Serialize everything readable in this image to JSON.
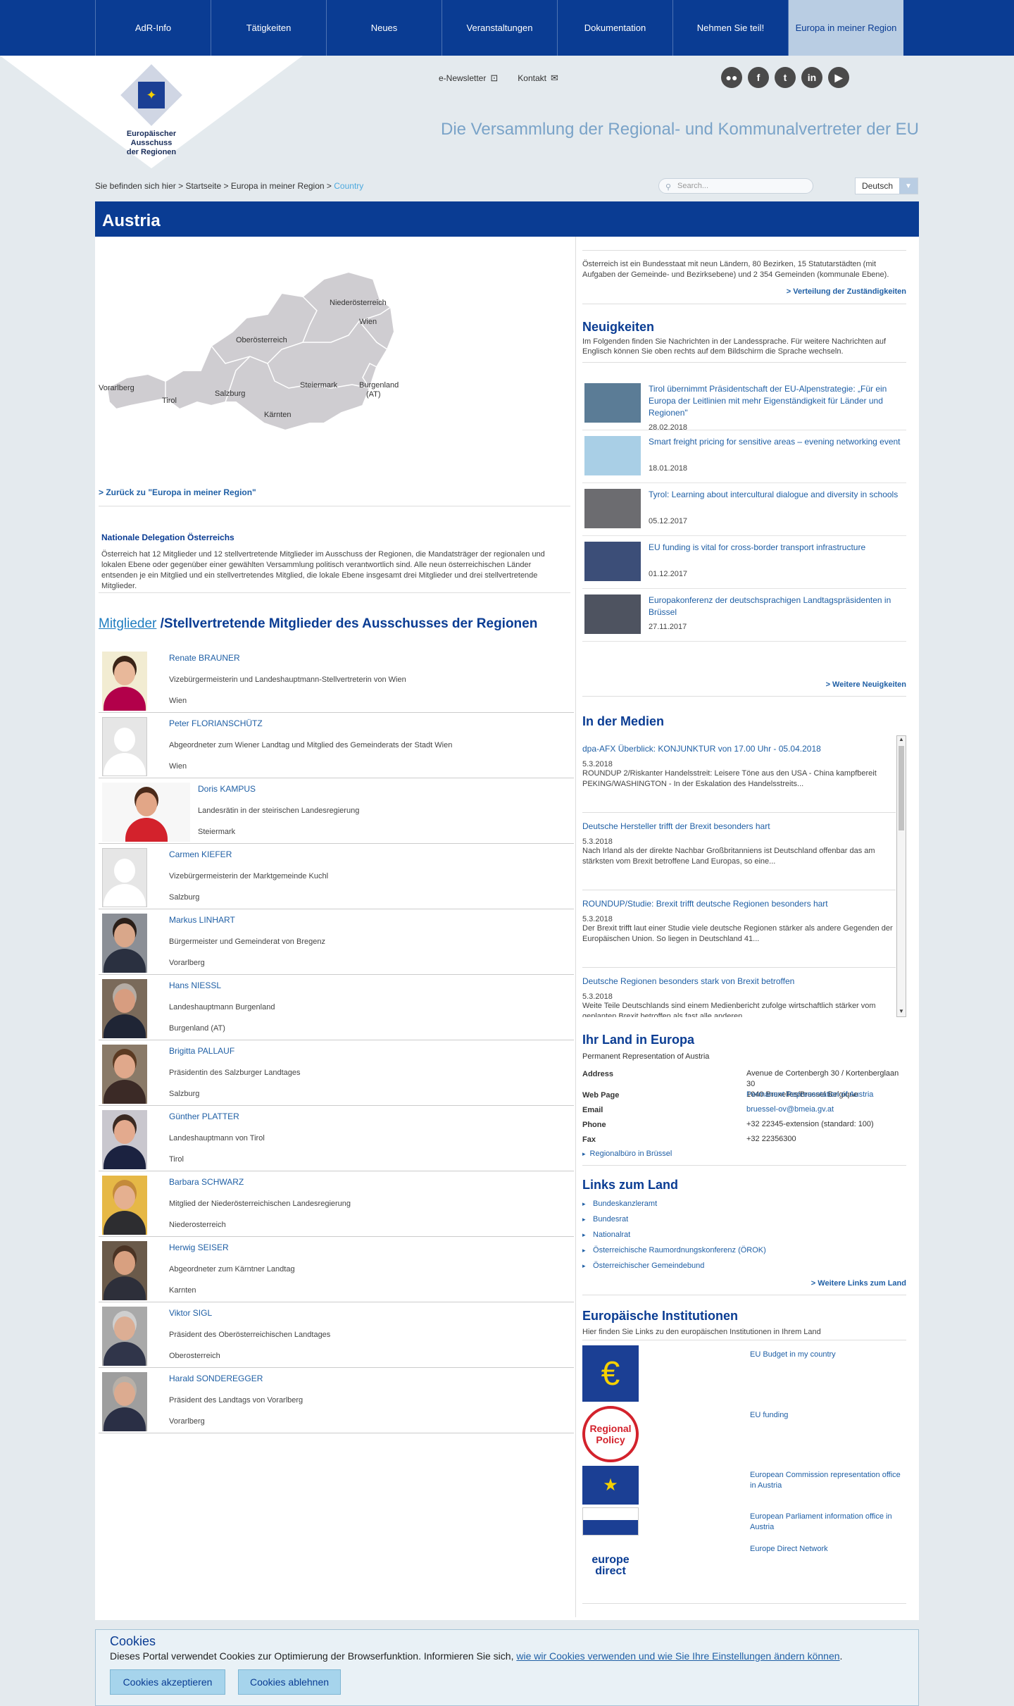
{
  "nav": [
    "AdR-Info",
    "Tätigkeiten",
    "Neues",
    "Veranstaltungen",
    "Dokumentation",
    "Nehmen Sie teil!",
    "Europa in meiner Region"
  ],
  "logo": {
    "line1": "Europäischer Ausschuss",
    "line2": "der Regionen"
  },
  "tools": {
    "newsletter": "e-Newsletter",
    "contact": "Kontakt"
  },
  "social": [
    "flickr-icon",
    "facebook-icon",
    "twitter-icon",
    "linkedin-icon",
    "youtube-icon"
  ],
  "tagline": "Die Versammlung der Regional- und Kommunalvertreter der EU",
  "breadcrumb": {
    "prefix": "Sie befinden sich hier >",
    "home": "Startseite",
    "section": "Europa in meiner Region",
    "current": "Country"
  },
  "search": {
    "placeholder": "Search..."
  },
  "language": "Deutsch",
  "page_title": "Austria",
  "map_regions": [
    "Niederösterreich",
    "Wien",
    "Oberösterreich",
    "Vorarlberg",
    "Tirol",
    "Salzburg",
    "Steiermark",
    "Burgenland",
    "(AT)",
    "Kärnten"
  ],
  "back_link": "> Zurück zu \"Europa in meiner Region\"",
  "delegation": {
    "title": "Nationale Delegation Österreichs",
    "text": "Österreich hat 12 Mitglieder und 12 stellvertretende Mitglieder im Ausschuss der Regionen, die Mandatsträger der regionalen und lokalen Ebene oder gegenüber einer gewählten Versammlung politisch verantwortlich sind. Alle neun österreichischen Länder entsenden je ein Mitglied und ein stellvertretendes Mitglied, die lokale Ebene insgesamt drei Mitglieder und drei stellvertretende Mitglieder."
  },
  "members_heading": {
    "tab_members": "Mitglieder",
    "rest": "/Stellvertretende Mitglieder des Ausschusses der Regionen"
  },
  "members": [
    {
      "name": "Renate BRAUNER",
      "role": "Vizebürgermeisterin und Landeshauptmann-Stellvertreterin von Wien",
      "place": "Wien",
      "skin": "#e8b89a",
      "hair": "#3a2418",
      "shirt": "#b2004a",
      "bg": "#f2ecd2"
    },
    {
      "name": "Peter FLORIANSCHÜTZ",
      "role": "Abgeordneter zum Wiener Landtag und Mitglied des Gemeinderats der Stadt Wien",
      "place": "Wien",
      "placeholder": true
    },
    {
      "name": "Doris KAMPUS",
      "role": "Landesrätin in der steirischen Landesregierung",
      "place": "Steiermark",
      "skin": "#e2a687",
      "hair": "#4a2a1a",
      "shirt": "#d3222c",
      "bg": "#f7f7f7",
      "wide": true
    },
    {
      "name": "Carmen KIEFER",
      "role": "Vizebürgermeisterin der Marktgemeinde Kuchl",
      "place": "Salzburg",
      "placeholder": true
    },
    {
      "name": "Markus LINHART",
      "role": "Bürgermeister und Gemeinderat von Bregenz",
      "place": "Vorarlberg",
      "skin": "#d9a78a",
      "hair": "#2a1e18",
      "shirt": "#2a3040",
      "bg": "#8b8f96"
    },
    {
      "name": "Hans NIESSL",
      "role": "Landeshauptmann Burgenland",
      "place": "Burgenland (AT)",
      "skin": "#d79d80",
      "hair": "#b5aca4",
      "shirt": "#1f2535",
      "bg": "#7a6a5a"
    },
    {
      "name": "Brigitta PALLAUF",
      "role": "Präsidentin des Salzburger Landtages",
      "place": "Salzburg",
      "skin": "#e0a88b",
      "hair": "#5b3a22",
      "shirt": "#3b2a26",
      "bg": "#8a7a68"
    },
    {
      "name": "Günther PLATTER",
      "role": "Landeshauptmann von Tirol",
      "place": "Tirol",
      "skin": "#e3aa8e",
      "hair": "#3b2a22",
      "shirt": "#1b2240",
      "bg": "#c9c7ce"
    },
    {
      "name": "Barbara SCHWARZ",
      "role": "Mitglied der Niederösterreichischen Landesregierung",
      "place": "Niederosterreich",
      "skin": "#e5b090",
      "hair": "#c48a3a",
      "shirt": "#2d2d30",
      "bg": "#e6b846"
    },
    {
      "name": "Herwig SEISER",
      "role": "Abgeordneter zum Kärntner Landtag",
      "place": "Karnten",
      "skin": "#d8a080",
      "hair": "#4a3324",
      "shirt": "#2d2f3a",
      "bg": "#6a5a4a"
    },
    {
      "name": "Viktor SIGL",
      "role": "Präsident des Oberösterreichischen Landtages",
      "place": "Oberosterreich",
      "skin": "#dcae94",
      "hair": "#cfcfcf",
      "shirt": "#30354a",
      "bg": "#a9a9a9"
    },
    {
      "name": "Harald SONDEREGGER",
      "role": "Präsident des Landtags von Vorarlberg",
      "place": "Vorarlberg",
      "skin": "#dcab90",
      "hair": "#b8b0a8",
      "shirt": "#2a2f45",
      "bg": "#9e9e9e"
    }
  ],
  "intro": "Österreich ist ein Bundesstaat mit neun Ländern, 80 Bezirken, 15 Statutarstädten (mit Aufgaben der Gemeinde- und Bezirksebene) und 2 354 Gemeinden (kommunale Ebene).",
  "intro_link": "> Verteilung der Zuständigkeiten",
  "news": {
    "heading": "Neuigkeiten",
    "sub": "Im Folgenden finden Sie Nachrichten in der Landessprache. Für weitere Nachrichten auf Englisch können Sie oben rechts auf dem Bildschirm die Sprache wechseln.",
    "items": [
      {
        "title": "Tirol übernimmt Präsidentschaft der EU-Alpenstrategie: „Für ein Europa der Leitlinien mit mehr Eigenständigkeit für Länder und Regionen\"",
        "date": "28.02.2018",
        "color": "#5b7c96"
      },
      {
        "title": "Smart freight pricing for sensitive areas – evening networking event",
        "date": "18.01.2018",
        "color": "#a9cfe6"
      },
      {
        "title": "Tyrol: Learning about intercultural dialogue and diversity in schools",
        "date": "05.12.2017",
        "color": "#6c6c70"
      },
      {
        "title": "EU funding is vital for cross-border transport infrastructure",
        "date": "01.12.2017",
        "color": "#3c4e78"
      },
      {
        "title": "Europakonferenz der deutschsprachigen Landtagspräsidenten in Brüssel",
        "date": "27.11.2017",
        "color": "#4e5360"
      }
    ],
    "more": "> Weitere Neuigkeiten"
  },
  "media": {
    "heading": "In der Medien",
    "items": [
      {
        "title": "dpa-AFX Überblick: KONJUNKTUR von 17.00 Uhr - 05.04.2018",
        "date": "5.3.2018",
        "text": "ROUNDUP 2/Riskanter Handelsstreit: Leisere Töne aus den USA - China kampfbereit PEKING/WASHINGTON - In der Eskalation des Handelsstreits..."
      },
      {
        "title": "Deutsche Hersteller trifft der Brexit besonders hart",
        "date": "5.3.2018",
        "text": "Nach Irland als der direkte Nachbar Großbritanniens ist Deutschland offenbar das am stärksten vom Brexit betroffene Land Europas, so eine..."
      },
      {
        "title": "ROUNDUP/Studie: Brexit trifft deutsche Regionen besonders hart",
        "date": "5.3.2018",
        "text": "Der Brexit trifft laut einer Studie viele deutsche Regionen stärker als andere Gegenden der Europäischen Union. So liegen in Deutschland 41..."
      },
      {
        "title": "Deutsche Regionen besonders stark von Brexit betroffen",
        "date": "5.3.2018",
        "text": "Weite Teile Deutschlands sind einem Medienbericht zufolge wirtschaftlich stärker vom geplanten Brexit betroffen als fast alle anderen..."
      }
    ]
  },
  "land": {
    "heading": "Ihr Land in Europa",
    "org": "Permanent Representation of Austria",
    "address_label": "Address",
    "address_line1": "Avenue de Cortenbergh 30 / Kortenberglaan 30",
    "address_line2": "1040 Bruxelles/Brussel Belgique",
    "web_label": "Web Page",
    "web_value": "Permanent Representation of Austria",
    "email_label": "Email",
    "email_value": "bruessel-ov@bmeia.gv.at",
    "phone_label": "Phone",
    "phone_value": "+32 22345-extension (standard: 100)",
    "fax_label": "Fax",
    "fax_value": "+32 22356300",
    "office_link": "Regionalbüro in Brüssel"
  },
  "links": {
    "heading": "Links zum Land",
    "items": [
      "Bundeskanzleramt",
      "Bundesrat",
      "Nationalrat",
      "Österreichische Raumordnungskonferenz (ÖROK)",
      "Österreichischer Gemeindebund"
    ],
    "more": "> Weitere Links zum Land"
  },
  "institutions": {
    "heading": "Europäische Institutionen",
    "sub": "Hier finden Sie Links zu den europäischen Institutionen in Ihrem Land",
    "items": [
      {
        "label": "EU Budget in my country",
        "logo_text": "€"
      },
      {
        "label": "EU funding",
        "logo_text": "Regional Policy"
      },
      {
        "label": "European Commission representation office in Austria",
        "logo_text": "★"
      },
      {
        "label": "European Parliament information office in Austria",
        "logo_text": ""
      },
      {
        "label": "Europe Direct Network",
        "logo_text": "europe direct"
      }
    ]
  },
  "cookies": {
    "title": "Cookies",
    "text": "Dieses Portal verwendet Cookies zur Optimierung der Browserfunktion. Informieren Sie sich,",
    "link": "wie wir Cookies verwenden und wie Sie Ihre Einstellungen ändern können",
    "accept": "Cookies akzeptieren",
    "reject": "Cookies ablehnen"
  },
  "colors": {
    "primary": "#0a3c93",
    "link": "#1f5fa5",
    "active_nav": "#b9cde3",
    "accent": "#4da9de"
  }
}
